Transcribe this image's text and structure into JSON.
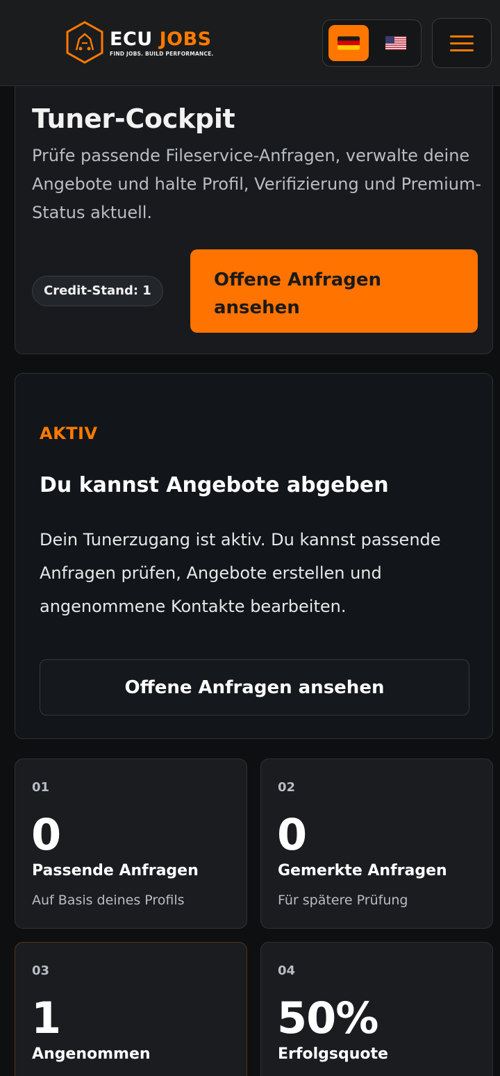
{
  "header": {
    "logo_word_1": "ECU",
    "logo_word_2": "JOBS",
    "logo_tagline": "FIND JOBS. BUILD PERFORMANCE.",
    "languages": [
      {
        "code": "de",
        "icon": "german-flag-icon",
        "active": true
      },
      {
        "code": "en",
        "icon": "us-flag-icon",
        "active": false
      }
    ],
    "menu_icon": "hamburger-menu-icon",
    "accent_color": "#ff7a00"
  },
  "hero": {
    "title": "Tuner-Cockpit",
    "description": "Prüfe passende Fileservice-Anfragen, verwalte deine Angebote und halte Profil, Verifizierung und Premium-Status aktuell.",
    "credit_label": "Credit-Stand: 1",
    "cta_label": "Offene Anfragen ansehen"
  },
  "status": {
    "tag": "AKTIV",
    "title": "Du kannst Angebote abgeben",
    "description": "Dein Tunerzugang ist aktiv. Du kannst passende Anfragen prüfen, Angebote erstellen und angenommene Kontakte bearbeiten.",
    "button_label": "Offene Anfragen ansehen"
  },
  "stats": [
    {
      "num": "01",
      "value": "0",
      "label": "Passende Anfragen",
      "sub": "Auf Basis deines Profils"
    },
    {
      "num": "02",
      "value": "0",
      "label": "Gemerkte Anfragen",
      "sub": "Für spätere Prüfung"
    },
    {
      "num": "03",
      "value": "1",
      "label": "Angenommen",
      "sub": ""
    },
    {
      "num": "04",
      "value": "50%",
      "label": "Erfolgsquote",
      "sub": ""
    }
  ]
}
